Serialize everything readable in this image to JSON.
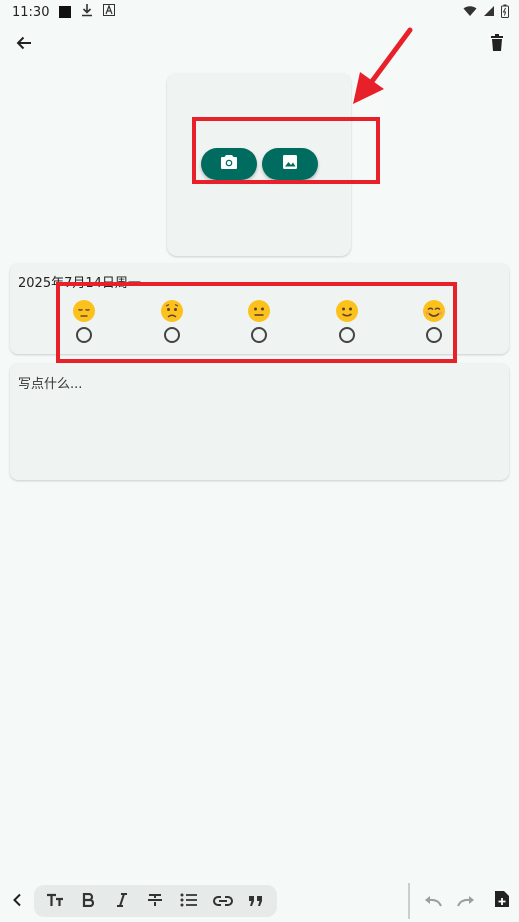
{
  "status_bar": {
    "time": "11:30",
    "icons": [
      "notification-square-icon",
      "download-icon",
      "font-a-icon",
      "wifi-icon",
      "signal-icon",
      "battery-icon"
    ]
  },
  "toolbar": {
    "back_icon": "arrow-left-icon",
    "delete_icon": "trash-icon"
  },
  "photo": {
    "camera_icon": "camera-icon",
    "gallery_icon": "image-icon"
  },
  "entry": {
    "date": "2025年7月14日周一",
    "moods": [
      {
        "emoji": "😔",
        "name": "pensive"
      },
      {
        "emoji": "😟",
        "name": "worried"
      },
      {
        "emoji": "😐",
        "name": "neutral"
      },
      {
        "emoji": "🙂",
        "name": "slightly-smiling"
      },
      {
        "emoji": "😊",
        "name": "smiling"
      }
    ],
    "note_placeholder": "写点什么..."
  },
  "format_bar": {
    "buttons": [
      "text-size-icon",
      "bold-icon",
      "italic-icon",
      "strikethrough-icon",
      "bullet-list-icon",
      "link-icon",
      "quote-icon"
    ]
  },
  "colors": {
    "background": "#f5faf8",
    "card": "#eff3f1",
    "accent": "#006b5f",
    "highlight": "#e8202a"
  }
}
